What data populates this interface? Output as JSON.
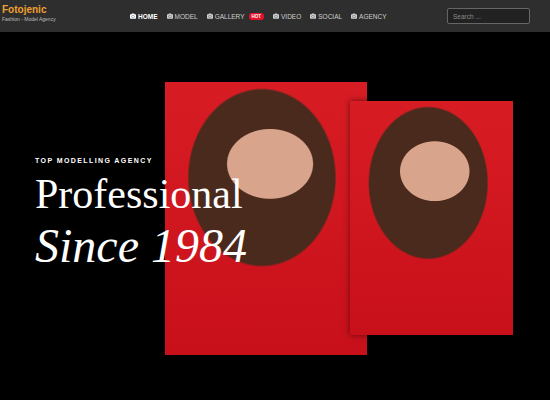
{
  "header": {
    "logo": "Fotojenic",
    "tagline": "Fashion - Model Agency"
  },
  "nav": [
    {
      "label": "HOME",
      "selected": true,
      "badge": ""
    },
    {
      "label": "MODEL",
      "selected": false,
      "badge": ""
    },
    {
      "label": "GALLERY",
      "selected": false,
      "badge": "HOT"
    },
    {
      "label": "VIDEO",
      "selected": false,
      "badge": ""
    },
    {
      "label": "SOCIAL",
      "selected": false,
      "badge": ""
    },
    {
      "label": "AGENCY",
      "selected": false,
      "badge": ""
    }
  ],
  "search": {
    "placeholder": "Search ..."
  },
  "hero": {
    "eyebrow": "TOP MODELLING AGENCY",
    "title": "Professional",
    "subtitle": "Since 1984"
  }
}
